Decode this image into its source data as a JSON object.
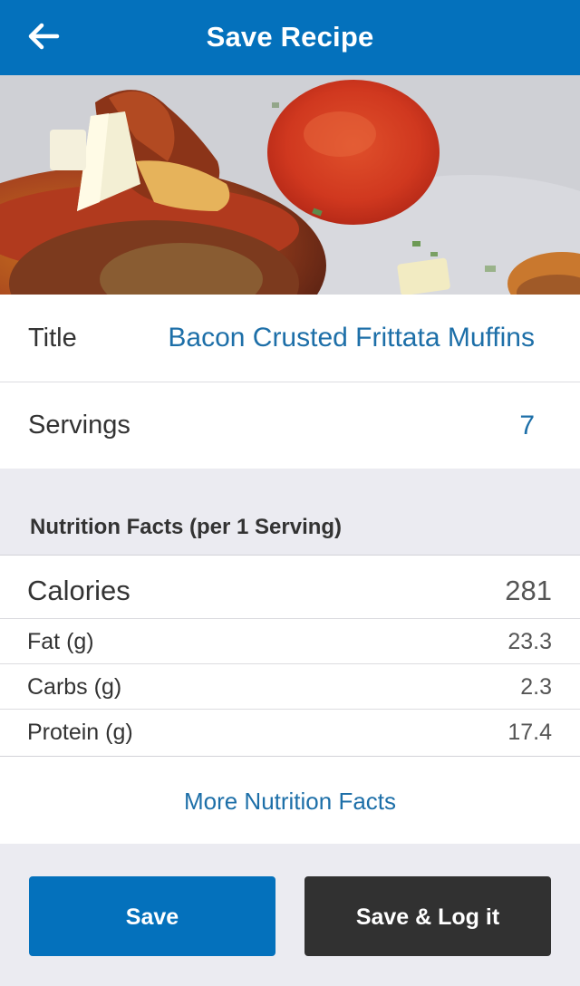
{
  "header": {
    "title": "Save Recipe",
    "back_icon": "arrow-left-icon"
  },
  "hero_image": {
    "subject": "food photo"
  },
  "form": {
    "title_label": "Title",
    "title_value": "Bacon Crusted Frittata Muffins",
    "servings_label": "Servings",
    "servings_value": "7"
  },
  "nutrition": {
    "heading": "Nutrition Facts (per 1 Serving)",
    "calories_label": "Calories",
    "calories_value": "281",
    "rows": [
      {
        "label": "Fat (g)",
        "value": "23.3"
      },
      {
        "label": "Carbs (g)",
        "value": "2.3"
      },
      {
        "label": "Protein (g)",
        "value": "17.4"
      }
    ],
    "more_link": "More Nutrition Facts"
  },
  "actions": {
    "save_label": "Save",
    "save_log_label": "Save & Log it"
  },
  "colors": {
    "brand": "#0471bc",
    "link": "#1d6fa8",
    "dark_button": "#313131",
    "page_bg": "#ebebf1"
  }
}
